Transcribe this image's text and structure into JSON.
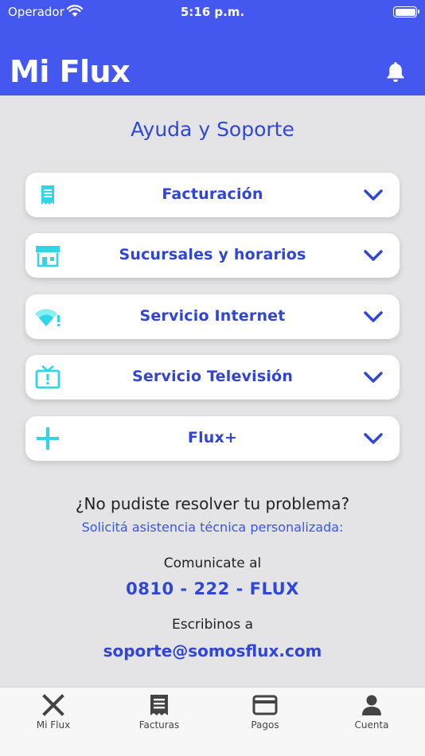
{
  "status_bar": {
    "carrier": "Operador",
    "time": "5:16 p.m."
  },
  "header": {
    "brand": "Mi Flux",
    "notification_icon": "bell-icon"
  },
  "page": {
    "title": "Ayuda y Soporte"
  },
  "sections": [
    {
      "label": "Facturación",
      "icon": "receipt-icon"
    },
    {
      "label": "Sucursales y horarios",
      "icon": "store-icon"
    },
    {
      "label": "Servicio Internet",
      "icon": "wifi-alert-icon"
    },
    {
      "label": "Servicio Televisión",
      "icon": "tv-alert-icon"
    },
    {
      "label": "Flux+",
      "icon": "plus-icon"
    }
  ],
  "help": {
    "question": "¿No pudiste resolver tu problema?",
    "assistance_link": "Solicitá asistencia técnica personalizada:",
    "call_label": "Comunicate al",
    "phone": "0810 - 222 - FLUX",
    "write_label": "Escribinos a",
    "email": "soporte@somosflux.com"
  },
  "tabs": [
    {
      "label": "Mi Flux",
      "icon": "flux-x-icon"
    },
    {
      "label": "Facturas",
      "icon": "invoice-icon"
    },
    {
      "label": "Pagos",
      "icon": "credit-card-icon"
    },
    {
      "label": "Cuenta",
      "icon": "user-icon"
    }
  ],
  "colors": {
    "header_bg": "#4458f0",
    "accent_blue": "#2f47d8",
    "icon_cyan": "#2fd6e6",
    "background": "#e4e4e6"
  }
}
